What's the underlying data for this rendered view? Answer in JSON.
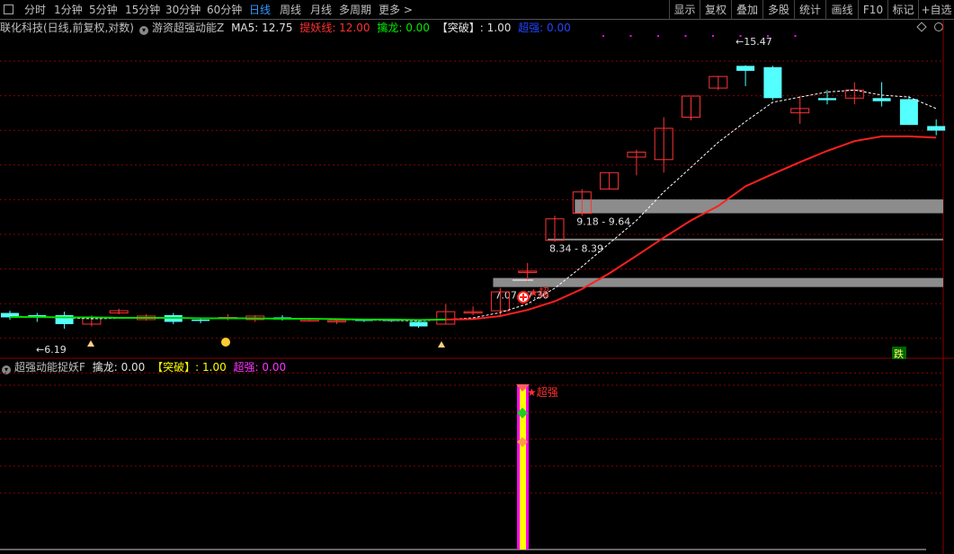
{
  "toolbar": {
    "periods": [
      "分时",
      "1分钟",
      "5分钟",
      "15分钟",
      "30分钟",
      "60分钟",
      "日线",
      "周线",
      "月线",
      "多周期",
      "更多 >"
    ],
    "active_period": "日线",
    "buttons": [
      "显示",
      "复权",
      "叠加",
      "多股",
      "统计",
      "画线",
      "F10",
      "标记",
      "+自选"
    ]
  },
  "main_header": {
    "title": "联化科技(日线,前复权,对数)",
    "indicator_name": "游资超强动能Z",
    "ma5": "MA5: 12.75",
    "tiyao": "提妖线: 12.00",
    "qinlong": "擒龙: 0.00",
    "tupo": "【突破】: 1.00",
    "chaoqiang": "超强: 0.00"
  },
  "sub_header": {
    "indicator_name": "超强动能捉妖F",
    "qinlong": "擒龙: 0.00",
    "tupo": "【突破】: 1.00",
    "chaoqiang": "超强: 0.00"
  },
  "colors": {
    "up": "#ff3333",
    "down": "#54ffff",
    "ma_white": "#ffffff",
    "tiyao_red": "#ff2020",
    "tiyao_green": "#00dd00",
    "grid": "#8b0000",
    "zone": "#8c8c8c",
    "magenta": "#ff00ff",
    "yellow": "#ffff00"
  },
  "chart_data": {
    "type": "candlestick",
    "ylim": [
      5.6,
      17.2
    ],
    "y_scale": "log",
    "candles": [
      [
        6.45,
        6.5,
        6.3,
        6.35
      ],
      [
        6.4,
        6.45,
        6.25,
        6.38
      ],
      [
        6.4,
        6.48,
        6.1,
        6.2
      ],
      [
        6.2,
        6.4,
        6.15,
        6.35
      ],
      [
        6.45,
        6.55,
        6.42,
        6.5
      ],
      [
        6.3,
        6.42,
        6.28,
        6.38
      ],
      [
        6.4,
        6.45,
        6.2,
        6.25
      ],
      [
        6.3,
        6.35,
        6.22,
        6.28
      ],
      [
        6.32,
        6.42,
        6.28,
        6.35
      ],
      [
        6.3,
        6.4,
        6.25,
        6.38
      ],
      [
        6.35,
        6.4,
        6.28,
        6.3
      ],
      [
        6.3,
        6.33,
        6.28,
        6.3
      ],
      [
        6.25,
        6.3,
        6.2,
        6.28
      ],
      [
        6.3,
        6.32,
        6.25,
        6.28
      ],
      [
        6.3,
        6.32,
        6.25,
        6.27
      ],
      [
        6.25,
        6.27,
        6.12,
        6.15
      ],
      [
        6.2,
        6.65,
        6.2,
        6.48
      ],
      [
        6.45,
        6.6,
        6.4,
        6.48
      ],
      [
        6.5,
        7.05,
        6.4,
        6.95
      ],
      [
        7.45,
        7.7,
        7.2,
        7.48
      ],
      [
        8.34,
        9.1,
        8.3,
        9.0
      ],
      [
        9.18,
        10.0,
        9.1,
        9.9
      ],
      [
        10.0,
        10.6,
        10.0,
        10.6
      ],
      [
        11.2,
        11.5,
        10.5,
        11.4
      ],
      [
        11.1,
        12.9,
        10.6,
        12.4
      ],
      [
        12.9,
        13.85,
        12.75,
        13.9
      ],
      [
        14.3,
        14.9,
        14.2,
        14.9
      ],
      [
        15.47,
        15.5,
        14.4,
        15.2
      ],
      [
        15.4,
        15.47,
        13.7,
        13.8
      ],
      [
        13.1,
        13.9,
        12.6,
        13.3
      ],
      [
        13.8,
        14.2,
        13.5,
        13.7
      ],
      [
        13.8,
        14.6,
        13.5,
        14.2
      ],
      [
        13.8,
        14.6,
        13.4,
        13.65
      ],
      [
        13.75,
        13.9,
        12.55,
        12.55
      ],
      [
        12.5,
        12.8,
        12.1,
        12.3
      ]
    ],
    "ma5_dashed": [
      6.38,
      6.36,
      6.34,
      6.32,
      6.33,
      6.33,
      6.33,
      6.34,
      6.33,
      6.33,
      6.33,
      6.32,
      6.3,
      6.29,
      6.28,
      6.27,
      6.3,
      6.34,
      6.46,
      6.66,
      7.04,
      7.6,
      8.25,
      8.95,
      9.9,
      10.8,
      11.8,
      12.7,
      13.6,
      13.85,
      14.1,
      14.2,
      13.95,
      13.85,
      13.3
    ],
    "tiyao_line": [
      6.36,
      6.36,
      6.35,
      6.35,
      6.34,
      6.34,
      6.34,
      6.33,
      6.33,
      6.33,
      6.32,
      6.32,
      6.31,
      6.3,
      6.3,
      6.29,
      6.3,
      6.31,
      6.38,
      6.52,
      6.72,
      7.02,
      7.42,
      7.9,
      8.42,
      8.95,
      9.42,
      10.1,
      10.55,
      11.0,
      11.45,
      11.85,
      12.05,
      12.05,
      12.0
    ],
    "zones": [
      {
        "label": "9.18 - 9.64",
        "low": 9.18,
        "high": 9.64,
        "from": 21
      },
      {
        "label": "8.34 - 8.39",
        "low": 8.34,
        "high": 8.39,
        "from": 20
      },
      {
        "label": "7.07 - 7.30",
        "low": 7.07,
        "high": 7.3,
        "from": 18
      }
    ],
    "annotations": {
      "low_label": "←6.19",
      "high_label": "←15.47",
      "chao_label": "超",
      "die_label": "跌",
      "sub_label": "超强"
    }
  }
}
